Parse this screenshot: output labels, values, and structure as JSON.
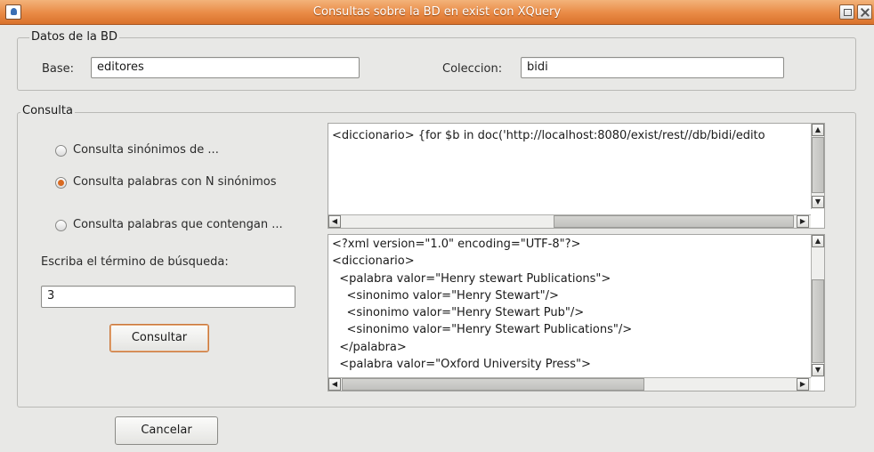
{
  "window": {
    "title": "Consultas sobre la BD en exist con XQuery"
  },
  "datos": {
    "legend": "Datos de la BD",
    "base_label": "Base:",
    "base_value": "editores",
    "coleccion_label": "Coleccion:",
    "coleccion_value": "bidi"
  },
  "consulta": {
    "legend": "Consulta",
    "options": [
      {
        "label": "Consulta sinónimos de ...",
        "selected": false
      },
      {
        "label": "Consulta palabras con N sinónimos",
        "selected": true
      },
      {
        "label": "Consulta palabras que contengan ...",
        "selected": false
      }
    ],
    "search_label": "Escriba el término de búsqueda:",
    "search_value": "3",
    "consultar_label": "Consultar",
    "query_text": "<diccionario> {for $b in doc('http://localhost:8080/exist/rest//db/bidi/edito",
    "result_text": "<?xml version=\"1.0\" encoding=\"UTF-8\"?>\n<diccionario>\n  <palabra valor=\"Henry stewart Publications\">\n    <sinonimo valor=\"Henry Stewart\"/>\n    <sinonimo valor=\"Henry Stewart Pub\"/>\n    <sinonimo valor=\"Henry Stewart Publications\"/>\n  </palabra>\n  <palabra valor=\"Oxford University Press\">"
  },
  "cancelar_label": "Cancelar",
  "colors": {
    "titlebar": "#e98a45",
    "radio_selected": "#d86a22",
    "background": "#e8e8e6"
  },
  "icons": [
    "app-icon",
    "maximize-icon",
    "close-icon",
    "arrow-up-icon",
    "arrow-down-icon",
    "arrow-left-icon",
    "arrow-right-icon"
  ]
}
